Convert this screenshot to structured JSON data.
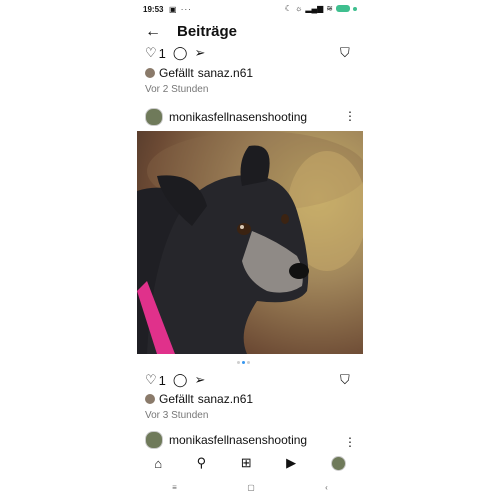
{
  "status_bar": {
    "time": "19:53",
    "icons_left": "▣ ···"
  },
  "header": {
    "title": "Beiträge"
  },
  "post1_bottom": {
    "like_count": "1",
    "liked_by_prefix": "Gefällt",
    "liked_by_user": "sanaz.n61",
    "time_ago": "Vor 2 Stunden"
  },
  "post2": {
    "username": "monikasfellnasenshooting",
    "like_count": "1",
    "liked_by_prefix": "Gefällt",
    "liked_by_user": "sanaz.n61",
    "time_ago": "Vor 3 Stunden"
  },
  "post3": {
    "username": "monikasfellnasenshooting"
  },
  "colors": {
    "accent": "#3897f0",
    "battery": "#3fbf8f",
    "collar": "#e0318b"
  }
}
